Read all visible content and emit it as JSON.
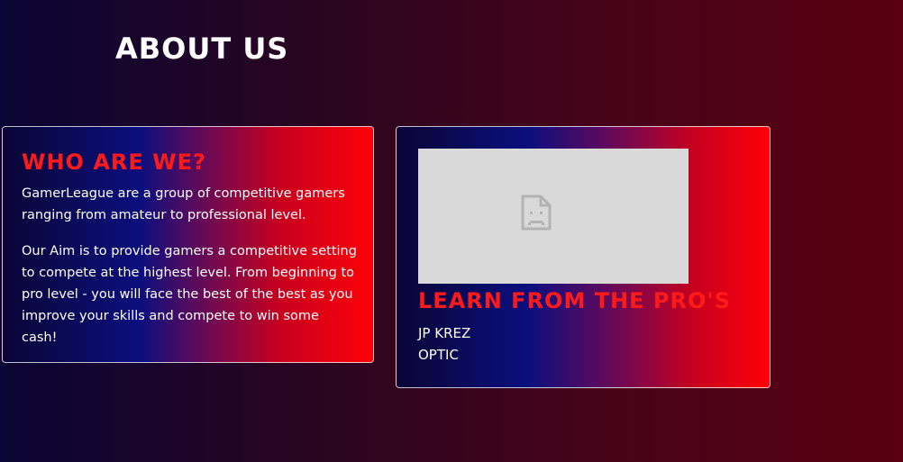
{
  "page": {
    "title": "ABOUT US"
  },
  "about_card": {
    "heading": "WHO ARE WE?",
    "paragraph_1": "GamerLeague are a group of competitive gamers ranging from amateur to professional level.",
    "paragraph_2": "Our Aim is to provide gamers a competitive setting to compete at the highest level. From beginning to pro level - you will face the best of the best as you improve your skills and compete to win some cash!"
  },
  "pros_card": {
    "video_icon": "broken-document-icon",
    "heading": "LEARN FROM THE PRO'S",
    "pros": [
      {
        "name": "JP KREZ"
      },
      {
        "name": "OPTIC"
      }
    ]
  },
  "colors": {
    "heading_red": "#ff1a1a",
    "text_white": "#ffffff",
    "video_placeholder": "#d9d9d9",
    "gradient_blue": "#0b0f7e",
    "gradient_red": "#ff0008"
  }
}
